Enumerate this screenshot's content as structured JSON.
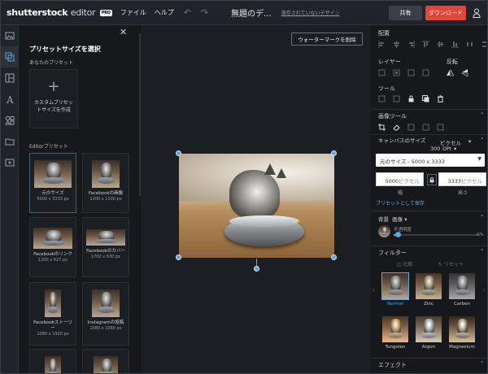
{
  "topbar": {
    "logo_brand": "shutterstock",
    "logo_editor": "editor",
    "logo_badge": "PRO",
    "menu_file": "ファイル",
    "menu_help": "ヘルプ",
    "doc_title": "無題のデ...",
    "unsaved": "保存されていないデザイン",
    "share": "共有",
    "download": "ダウンロード"
  },
  "panel": {
    "title": "プリセットサイズを選択",
    "your_presets": "あなたのプリセット",
    "custom_label": "カスタムプリセットサイズを作成",
    "editor_presets": "Editorプリセット",
    "presets": [
      {
        "name": "元のサイズ",
        "size": "5000 x 3333 px"
      },
      {
        "name": "Facebookの画像",
        "size": "1200 x 1200 px"
      },
      {
        "name": "Facebookのリンク",
        "size": "1200 x 627 px"
      },
      {
        "name": "Facebookのカバー",
        "size": "1702 x 630 px"
      },
      {
        "name": "Facebookストーリー",
        "size": "1080 x 1920 px"
      },
      {
        "name": "Instagramの投稿",
        "size": "1080 x 1080 px"
      }
    ]
  },
  "canvas": {
    "watermark_button": "ウォーターマークを削除"
  },
  "right": {
    "align_label": "配置",
    "layer_label": "レイヤー",
    "flip_label": "反転",
    "tools_label": "ツール",
    "image_tools_label": "画像ツール",
    "canvas_size_label": "キャンバスのサイズ",
    "unit": "ピクセル",
    "dpi_value": "300",
    "dpi_label": "DPI",
    "size_select": "元のサイズ - 5000 x 3333",
    "width_value": "5000",
    "height_value": "3333",
    "unit_suffix": "ピクセル",
    "width_label": "幅",
    "height_label": "高さ",
    "save_preset": "プリセットとして保存",
    "background_label": "背景",
    "background_type": "画像",
    "opacity_label": "不透明度",
    "opacity_value": "0%",
    "opacity_fraction": 0.05,
    "filter_label": "フィルター",
    "compare_label": "比較",
    "reset_label": "リセット",
    "filters": [
      "Normal",
      "Zinc",
      "Carbon",
      "Tungsten",
      "Argon",
      "Magnesium"
    ],
    "effects_label": "エフェクト"
  }
}
